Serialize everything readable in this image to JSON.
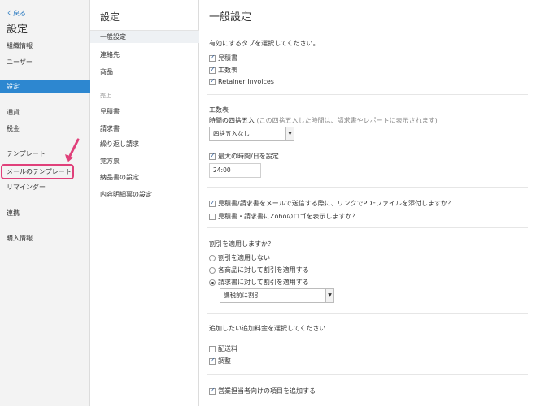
{
  "sidebar": {
    "back_label": "く戻る",
    "title": "設定",
    "items": [
      {
        "label": "組織情報"
      },
      {
        "label": "ユーザー"
      },
      {
        "label": "設定"
      },
      {
        "label": "通貨"
      },
      {
        "label": "税金"
      },
      {
        "label": "テンプレート"
      },
      {
        "label": "メールのテンプレート"
      },
      {
        "label": "リマインダー"
      },
      {
        "label": "連携"
      },
      {
        "label": "購入情報"
      }
    ],
    "active_index": 2,
    "highlight_color": "#e0407a"
  },
  "middle": {
    "title": "設定",
    "items": [
      {
        "label": "一般設定"
      },
      {
        "label": "連絡先"
      },
      {
        "label": "商品"
      }
    ],
    "section_label": "売上",
    "sales_items": [
      {
        "label": "見積書"
      },
      {
        "label": "請求書"
      },
      {
        "label": "繰り返し請求"
      },
      {
        "label": "覚方票"
      },
      {
        "label": "納品書の設定"
      },
      {
        "label": "内容明細票の設定"
      }
    ]
  },
  "main": {
    "title": "一般設定",
    "tabs_prompt": "有効にするタブを選択してください。",
    "tabs": [
      {
        "label": "見積書",
        "checked": true
      },
      {
        "label": "工数表",
        "checked": true
      },
      {
        "label": "Retainer Invoices",
        "checked": true
      }
    ],
    "timesheet_heading": "工数表",
    "rounding_label": "時間の四捨五入",
    "rounding_note": "(この四捨五入した時間は、請求書やレポートに表示されます)",
    "rounding_value": "四捨五入なし",
    "max_hours": {
      "label": "最大の時間/日を設定",
      "checked": true
    },
    "max_hours_value": "24:00",
    "attach_pdf": {
      "label": "見積書/請求書をメールで送信する際に、リンクでPDFファイルを添付しますか？",
      "checked": true
    },
    "show_logo": {
      "label": "見積書・請求書にZohoのロゴを表示しますか？",
      "checked": false
    },
    "discount_heading": "割引を適用しますか？",
    "discount_options": [
      {
        "label": "割引を適用しない",
        "selected": false
      },
      {
        "label": "各商品に対して割引を適用する",
        "selected": false
      },
      {
        "label": "請求書に対して割引を適用する",
        "selected": true
      }
    ],
    "discount_select_value": "課税前に割引",
    "charges_heading": "追加したい追加料金を選択してください",
    "charges": [
      {
        "label": "配送料",
        "checked": false
      },
      {
        "label": "調整",
        "checked": true
      }
    ],
    "salesperson": {
      "label": "営業担当者向けの項目を追加する",
      "checked": true
    }
  },
  "colors": {
    "accent": "#2d87d0",
    "link": "#2a7ac0"
  }
}
